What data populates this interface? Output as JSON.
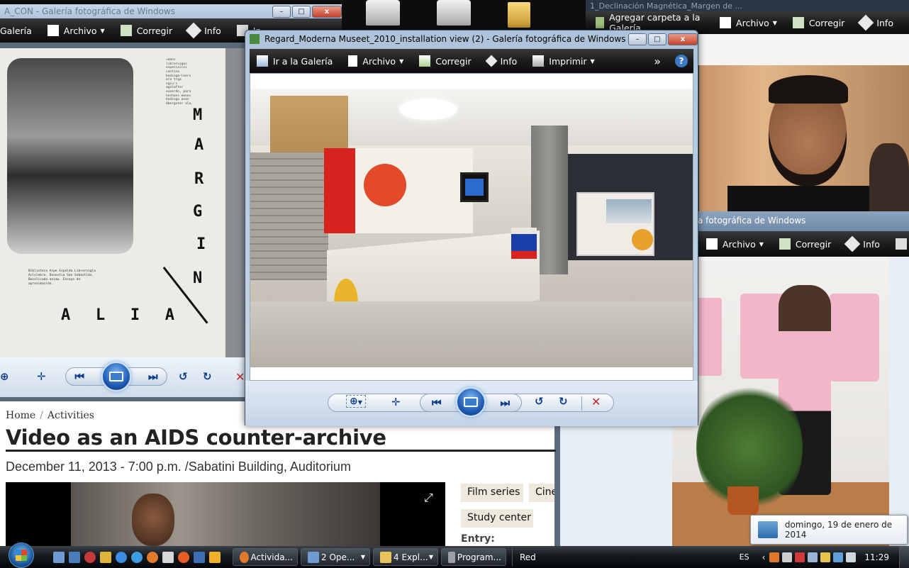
{
  "desktop": {
    "icons": [
      "printer-icon",
      "printer-icon",
      "folder-icon"
    ]
  },
  "left_window": {
    "title": "A_CON - Galería fotográfica de Windows",
    "menu": [
      "Galería",
      "Archivo",
      "Corregir",
      "Info",
      "In"
    ],
    "book_letters": [
      "M",
      "A",
      "R",
      "G",
      "I",
      "N"
    ],
    "book_footer": [
      "A",
      "L",
      "I",
      "A"
    ],
    "book_body_text": "«Dans libreruigas especializi contina bodinga—leers era trga sgiu's agalafter ocmerdo, para hochens menos bodinga anas Ubergoter ala. ",
    "book_small_text": "Biblioteca Arpe Espalda Libreroigla Aclolebra. Donostia San Sebastián. Bucolicada anima. Ensayo de aproximación."
  },
  "right_top_window": {
    "title": "1_Declinación Magnética_Margen de ...",
    "menu": [
      "Agregar carpeta a la Galería",
      "Archivo",
      "Corregir",
      "Info"
    ],
    "subtitle": "a fotográfica de Windows"
  },
  "right_bottom_window": {
    "menu": [
      "Archivo",
      "Corregir",
      "Info",
      "I"
    ]
  },
  "main_window": {
    "title": "Regard_Moderna Museet_2010_installation view (2) - Galería fotográfica de Windows",
    "menu": [
      {
        "label": "Ir a la Galería",
        "icon": "gallery-icon",
        "caret": false
      },
      {
        "label": "Archivo",
        "icon": "file-icon",
        "caret": true
      },
      {
        "label": "Corregir",
        "icon": "fix-icon",
        "caret": false
      },
      {
        "label": "Info",
        "icon": "tag-icon",
        "caret": false
      },
      {
        "label": "Imprimir",
        "icon": "printer-icon",
        "caret": true
      }
    ],
    "more_glyph": "»",
    "help_glyph": "?"
  },
  "webpage": {
    "breadcrumb_home": "Home",
    "breadcrumb_sep": "/",
    "breadcrumb_current": "Activities",
    "headline": "Video as an AIDS counter-archive",
    "dateline": "December 11, 2013 - 7:00 p.m. /Sabatini Building, Auditorium",
    "tags": [
      "Film series",
      "Cine",
      "Study center"
    ],
    "entry_label": "Entry:"
  },
  "taskbar": {
    "tasks": [
      {
        "label": "Activida...",
        "icon": "firefox-icon",
        "caret": false
      },
      {
        "label": "2 Ope...",
        "icon": "gallery-icon",
        "caret": true
      },
      {
        "label": "4 Expl...",
        "icon": "folder-icon",
        "caret": true
      },
      {
        "label": "Program...",
        "icon": "program-icon",
        "caret": false
      }
    ],
    "network_label": "Red",
    "language": "ES",
    "time": "11:29",
    "date_popup": "domingo, 19 de enero de 2014"
  }
}
